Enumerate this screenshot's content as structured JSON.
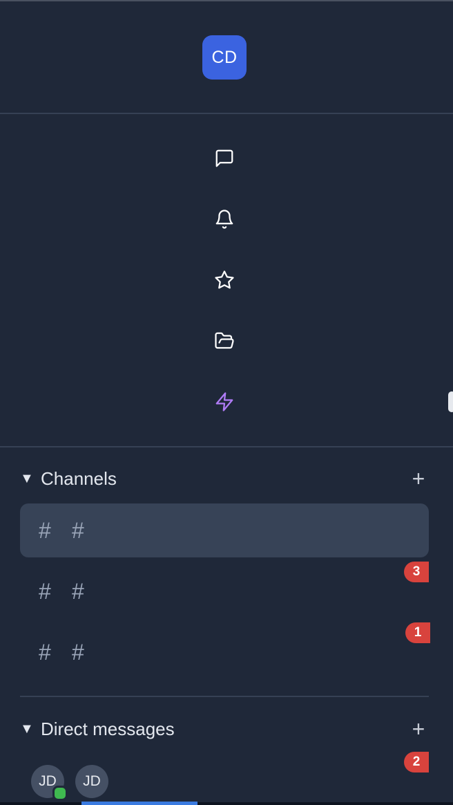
{
  "workspace": {
    "initials": "CD",
    "color": "#3b63e0"
  },
  "nav": {
    "icons": [
      "message-square-icon",
      "bell-icon",
      "star-icon",
      "folder-open-icon",
      "zap-icon"
    ],
    "accent": "#b07cf7"
  },
  "channels": {
    "caret": "▼",
    "title": "Channels",
    "add_label": "+",
    "items": [
      {
        "prefix": "#",
        "icon": "#",
        "name": "",
        "badge": "",
        "active": true
      },
      {
        "prefix": "#",
        "icon": "#",
        "name": "",
        "badge": "3",
        "active": false
      },
      {
        "prefix": "#",
        "icon": "#",
        "name": "",
        "badge": "1",
        "active": false
      }
    ]
  },
  "direct_messages": {
    "caret": "▼",
    "title": "Direct messages",
    "add_label": "+",
    "badge": "2",
    "avatars": [
      {
        "initials": "JD",
        "online": true
      },
      {
        "initials": "JD",
        "online": false
      }
    ]
  },
  "colors": {
    "background": "#1f2839",
    "active_channel": "#374357",
    "badge": "#d8433d",
    "online": "#3fb950"
  }
}
